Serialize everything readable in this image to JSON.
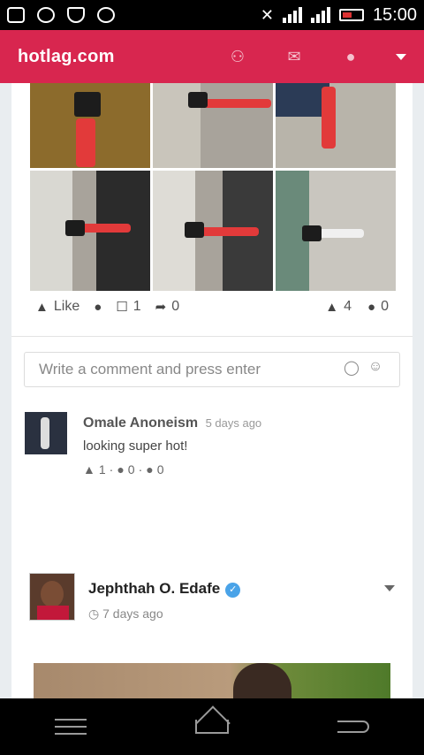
{
  "status_bar": {
    "time": "15:00",
    "icons": [
      "messages-icon",
      "instagram-icon",
      "shield-icon",
      "upload-icon",
      "mute-icon",
      "signal-icon",
      "signal-icon",
      "battery-icon"
    ]
  },
  "app": {
    "brand": "hotlag.com",
    "nav_icons": [
      "friends-icon",
      "chat-icon",
      "globe-icon",
      "caret-down-icon"
    ],
    "accent_color": "#d8264f"
  },
  "post1": {
    "actions": {
      "like_label": "Like",
      "comments_count": "1",
      "shares_count": "0",
      "likes_count": "4",
      "dislikes_count": "0"
    },
    "comment_input": {
      "placeholder": "Write a comment and press enter"
    },
    "comment": {
      "author": "Omale Anoneism",
      "time": "5 days ago",
      "text": "looking super hot!",
      "likes": "1",
      "dislikes": "0",
      "replies": "0"
    }
  },
  "post2": {
    "author": "Jephthah O. Edafe",
    "time": "7 days ago"
  }
}
